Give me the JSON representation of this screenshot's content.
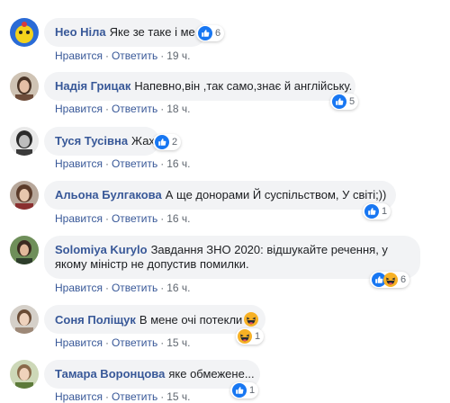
{
  "actions": {
    "like": "Нравится",
    "reply": "Ответить",
    "separator": "·"
  },
  "colors": {
    "author": "#385898",
    "bubble": "#f2f3f5",
    "like_blue": "#1877f2",
    "haha_yellow": "#f7b125"
  },
  "comments": [
    {
      "author": "Нео Ніла",
      "text": "Яке зе таке і ме",
      "time": "19 ч.",
      "reactions": "6",
      "reaction_icons": [
        "like-icon"
      ],
      "avatar": "avatar-neo"
    },
    {
      "author": "Надія Грицак",
      "text": "Напевно,він ,так само,знає й англійську.",
      "time": "18 ч.",
      "reactions": "5",
      "reaction_icons": [
        "like-icon"
      ],
      "avatar": "avatar-nadiya"
    },
    {
      "author": "Туся Тусівна",
      "text": "Жах.",
      "time": "16 ч.",
      "reactions": "2",
      "reaction_icons": [
        "like-icon"
      ],
      "avatar": "avatar-tusya"
    },
    {
      "author": "Альона Булгакова",
      "text": "А ще донорами Й суспільством, У світі;))",
      "time": "16 ч.",
      "reactions": "1",
      "reaction_icons": [
        "like-icon"
      ],
      "avatar": "avatar-alona"
    },
    {
      "author": "Solomiya Kurylo",
      "text": "Завдання ЗНО 2020: відшукайте речення, у якому міністр не допустив помилки.",
      "time": "16 ч.",
      "reactions": "6",
      "reaction_icons": [
        "like-icon",
        "haha-icon"
      ],
      "avatar": "avatar-solomiya"
    },
    {
      "author": "Соня Поліщук",
      "text": "В мене очі потекли",
      "time": "15 ч.",
      "reactions": "1",
      "reaction_icons": [
        "haha-icon"
      ],
      "avatar": "avatar-sonya",
      "inline_emoji": "laughing-emoji-icon"
    },
    {
      "author": "Тамара Воронцова",
      "text": "яке обмежене...",
      "time": "15 ч.",
      "reactions": "1",
      "reaction_icons": [
        "like-icon"
      ],
      "avatar": "avatar-tamara"
    }
  ]
}
